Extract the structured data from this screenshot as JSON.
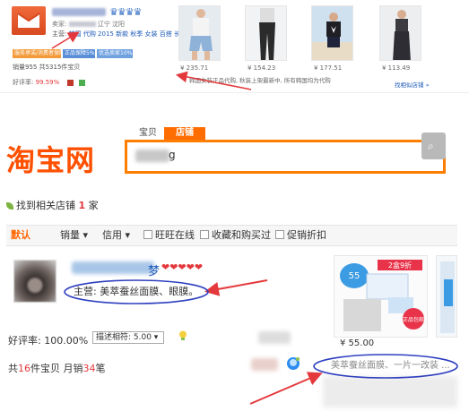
{
  "top_shop": {
    "location": "辽宁 沈阳",
    "location_prefix": "卖家:",
    "main_label": "主营:",
    "main_keywords": "韩国 代购 2015 新款 秋季 女装 百搭 长袖 ...",
    "badges": [
      "服务承诺/消费者保障",
      "正品保障5%",
      "优选卖家10%"
    ],
    "sales": "销量955  共5315件宝贝",
    "rating_label": "好评率:",
    "rating_value": "99.59%",
    "fake_note": "韩国女装正品代购, 秋装上架最新中, 所有韩国均为代购",
    "more_link": "找相似店铺 »"
  },
  "thumbnails": [
    {
      "price": "¥ 235.71",
      "color": "#cfd9e4"
    },
    {
      "price": "¥ 154.23",
      "color": "#eef1f4"
    },
    {
      "price": "¥ 177.51",
      "color": "#d7e3ef"
    },
    {
      "price": "¥ 113.49",
      "color": "#e9ecef"
    }
  ],
  "taobao": {
    "logo": "淘宝网",
    "tabs": [
      "宝贝",
      "店铺"
    ],
    "search_value": "g",
    "found_prefix": "找到相关店铺",
    "found_count": "1",
    "found_suffix": "家",
    "sort_default": "默认",
    "sort_sales": "销量 ▾",
    "sort_credit": "信用 ▾",
    "filters": [
      "旺旺在线",
      "收藏和购买过",
      "促销折扣"
    ]
  },
  "result": {
    "shop_name_visible": "梦",
    "hearts": "❤❤❤❤❤",
    "main": "主营: 美萃蚕丝面膜、眼膜。",
    "rating": "好评率: 100.00%",
    "select_value": "描述相符: 5.00 ▾",
    "count_prefix": "共",
    "count_items": "16",
    "count_mid": "件宝贝 月销",
    "count_sales": "34",
    "count_suffix": "笔",
    "product_price": "¥ 55.00",
    "product_tag1": "2盒9折",
    "product_tag2": "正品包邮",
    "main_right": "美萃蚕丝面膜、一片一改装 ..."
  },
  "colors": {
    "taobao_orange": "#ff5000",
    "accent_orange": "#ff6d00",
    "link_blue": "#1e5bb8",
    "annotation_red": "#e4393c",
    "ellipse_blue": "#2e3fbf"
  }
}
